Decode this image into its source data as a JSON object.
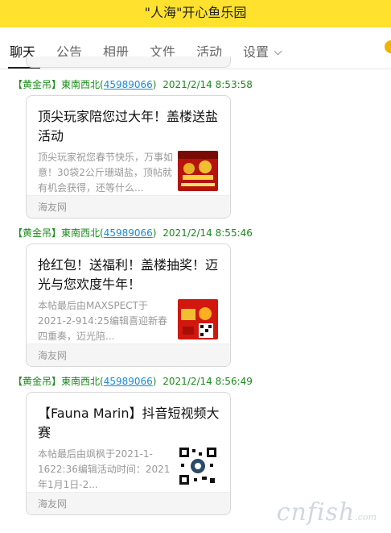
{
  "window": {
    "title": "\"人海\"开心鱼乐园"
  },
  "tabs": [
    {
      "label": "聊天"
    },
    {
      "label": "公告"
    },
    {
      "label": "相册"
    },
    {
      "label": "文件"
    },
    {
      "label": "活动"
    },
    {
      "label": "设置"
    }
  ],
  "messages": [
    {
      "sender_prefix": "【黄金吊】東南西北(",
      "qq": "45989066",
      "sender_suffix": ")",
      "time": "2021/2/14 8:53:58",
      "card": {
        "title": "顶尖玩家陪您过大年！盖楼送盐活动",
        "desc": "顶尖玩家祝您春节快乐，万事如意！30袋2公斤珊瑚盐，顶帖就有机会获得，还等什么...",
        "source": "海友网",
        "thumb_icon": "red-newyear-banner-thumbnail"
      }
    },
    {
      "sender_prefix": "【黄金吊】東南西北(",
      "qq": "45989066",
      "sender_suffix": ")",
      "time": "2021/2/14 8:55:46",
      "card": {
        "title": "抢红包！送福利！盖楼抽奖！迈光与您欢度牛年！",
        "desc": "本帖最后由MAXSPECT于2021-2-914:25编辑喜迎新春四重奏，迈光陪...",
        "source": "海友网",
        "thumb_icon": "red-envelope-qrcode-thumbnail"
      }
    },
    {
      "sender_prefix": "【黄金吊】東南西北(",
      "qq": "45989066",
      "sender_suffix": ")",
      "time": "2021/2/14 8:56:49",
      "card": {
        "title": "【Fauna Marin】抖音短视频大赛",
        "desc": "本帖最后由飒枫于2021-1-1622:36编辑活动时间：2021年1月1日-2...",
        "source": "海友网",
        "thumb_icon": "qrcode-thumbnail"
      }
    }
  ],
  "watermark": {
    "brand": "cnfish",
    "suffix": ".com"
  },
  "colors": {
    "titlebar": "#ffe12e",
    "sender": "#1a8a1a",
    "qq_link": "#1a8ad6"
  }
}
